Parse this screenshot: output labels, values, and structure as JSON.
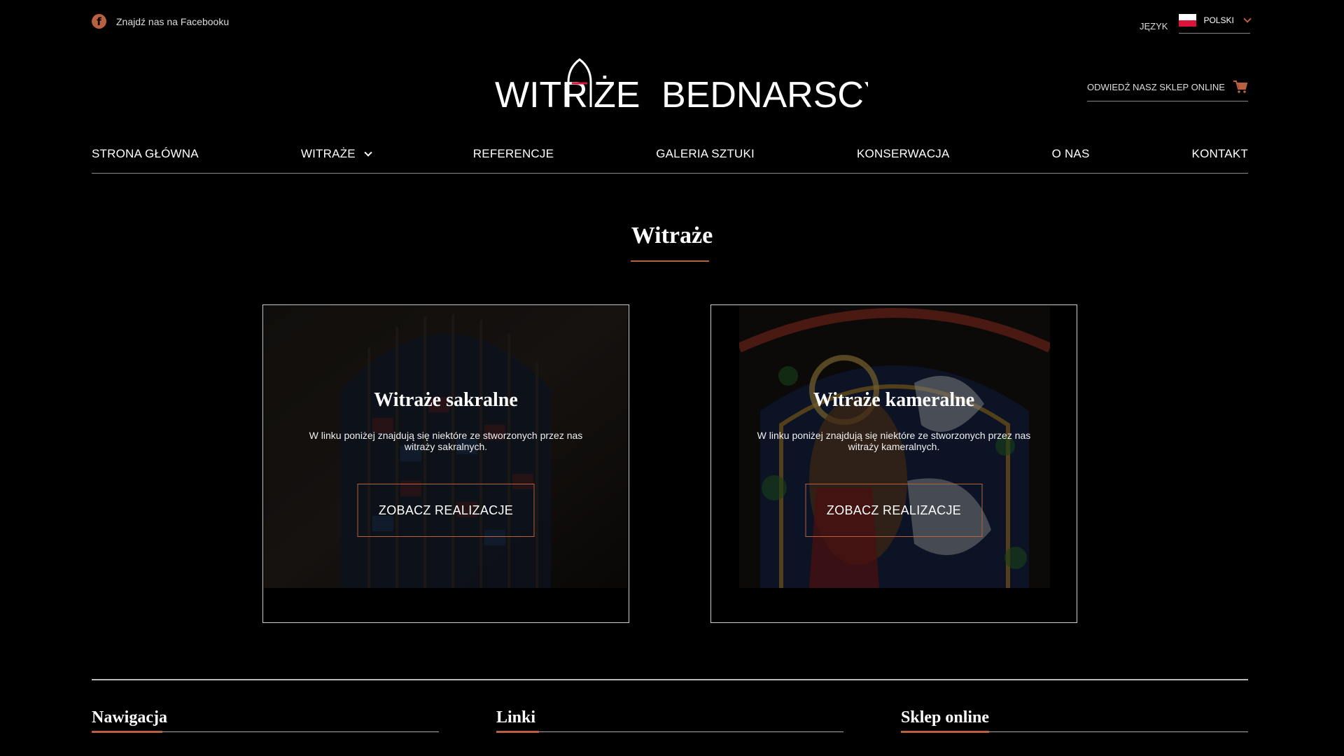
{
  "topbar": {
    "facebook_text": "Znajdź nas na Facebooku",
    "facebook_icon": "facebook-icon",
    "language_label": "JĘZYK",
    "language_value": "POLSKI",
    "language_flag": "poland-flag-icon"
  },
  "logo": {
    "text_left": "WITR",
    "text_mid": "ŻE",
    "text_right": "BEDNARSCY"
  },
  "shop_link": {
    "label": "ODWIEDŹ NASZ SKLEP ONLINE",
    "icon": "cart-icon"
  },
  "nav": {
    "items": [
      {
        "label": "STRONA GŁÓWNA"
      },
      {
        "label": "WITRAŻE",
        "has_dropdown": true
      },
      {
        "label": "REFERENCJE"
      },
      {
        "label": "GALERIA SZTUKI"
      },
      {
        "label": "KONSERWACJA"
      },
      {
        "label": "O NAS"
      },
      {
        "label": "KONTAKT"
      }
    ]
  },
  "section": {
    "title": "Witraże"
  },
  "cards": [
    {
      "title": "Witraże sakralne",
      "description": "W linku poniżej znajdują się niektóre ze stworzonych przez nas witraży sakralnych.",
      "button": "ZOBACZ REALIZACJE"
    },
    {
      "title": "Witraże kameralne",
      "description": "W linku poniżej znajdują się niektóre ze stworzonych przez nas witraży kameralnych.",
      "button": "ZOBACZ REALIZACJE"
    }
  ],
  "footer": {
    "columns": [
      {
        "title": "Nawigacja"
      },
      {
        "title": "Linki"
      },
      {
        "title": "Sklep online"
      }
    ]
  },
  "colors": {
    "background": "#000000",
    "accent": "#b8603f",
    "text": "#ffffff"
  }
}
